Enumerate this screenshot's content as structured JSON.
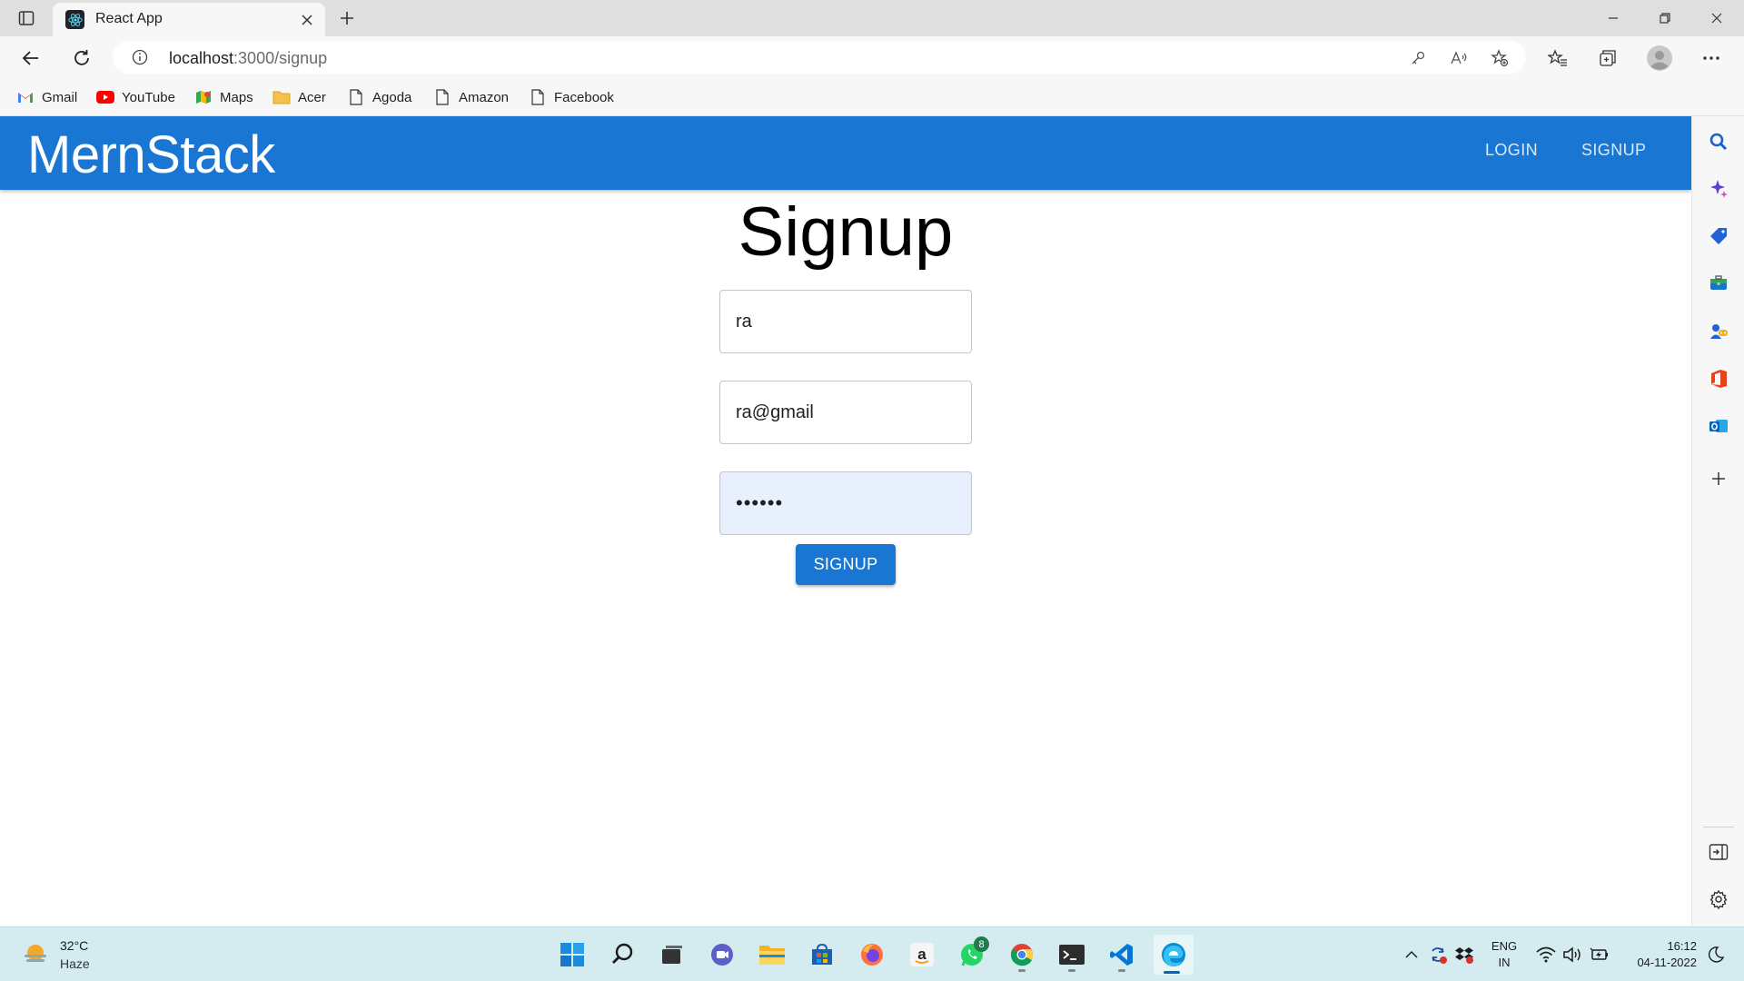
{
  "browser": {
    "tab_title": "React App",
    "url_host": "localhost",
    "url_path": ":3000/signup",
    "bookmarks": [
      {
        "label": "Gmail",
        "icon": "gmail-icon"
      },
      {
        "label": "YouTube",
        "icon": "youtube-icon"
      },
      {
        "label": "Maps",
        "icon": "maps-icon"
      },
      {
        "label": "Acer",
        "icon": "folder-icon"
      },
      {
        "label": "Agoda",
        "icon": "page-icon"
      },
      {
        "label": "Amazon",
        "icon": "page-icon"
      },
      {
        "label": "Facebook",
        "icon": "page-icon"
      }
    ]
  },
  "app": {
    "brand": "MernStack",
    "nav": {
      "login": "LOGIN",
      "signup": "SIGNUP"
    },
    "page_title": "Signup",
    "form": {
      "name_value": "ra",
      "email_value": "ra@gmail",
      "password_value": "••••••",
      "submit_label": "SIGNUP"
    },
    "colors": {
      "primary": "#1976d2",
      "autofill": "#e8f0fe"
    }
  },
  "taskbar": {
    "weather_temp": "32°C",
    "weather_condition": "Haze",
    "whatsapp_badge": "8",
    "lang_line1": "ENG",
    "lang_line2": "IN",
    "time": "16:12",
    "date": "04-11-2022"
  }
}
